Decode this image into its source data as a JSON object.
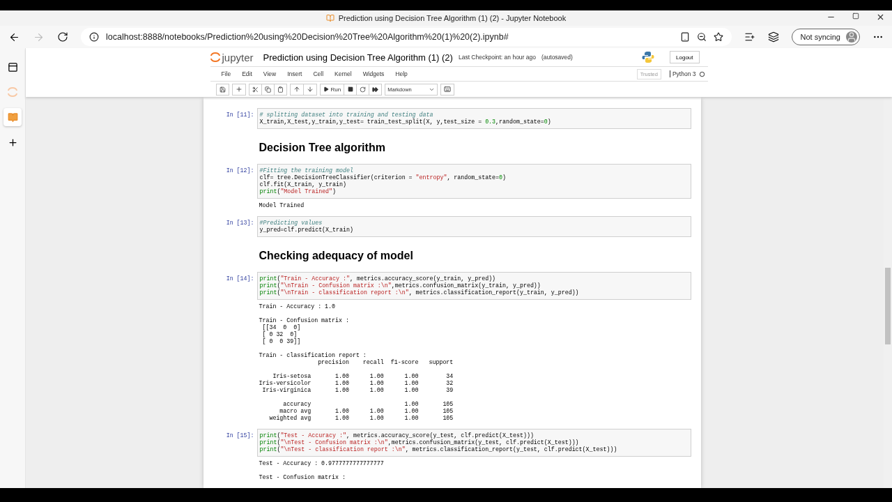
{
  "browser": {
    "tab_title": "Prediction using Decision Tree Algorithm (1) (2) - Jupyter Notebook",
    "url": "localhost:8888/notebooks/Prediction%20using%20Decision%20Tree%20Algorithm%20(1)%20(2).ipynb#",
    "profile": "Not syncing"
  },
  "jupyter": {
    "logo": "jupyter",
    "title": "Prediction using Decision Tree Algorithm (1) (2)",
    "checkpoint": "Last Checkpoint: an hour ago",
    "autosave": "(autosaved)",
    "logout": "Logout",
    "menu": [
      "File",
      "Edit",
      "View",
      "Insert",
      "Cell",
      "Kernel",
      "Widgets",
      "Help"
    ],
    "trusted": "Trusted",
    "kernel": "Python 3",
    "run": "Run",
    "cell_type": "Markdown"
  },
  "cells": [
    {
      "kind": "code",
      "prompt": "In [11]:",
      "lines": [
        [
          {
            "kind": "comment",
            "text": "# splitting dataset into training and testing data"
          }
        ],
        [
          {
            "kind": "plain",
            "text": "X_train,X_test,y_train,y_test= train_test_split(X, y,test_size = "
          },
          {
            "kind": "number",
            "text": "0.3"
          },
          {
            "kind": "plain",
            "text": ",random_state="
          },
          {
            "kind": "number",
            "text": "0"
          },
          {
            "kind": "plain",
            "text": ")"
          }
        ]
      ]
    },
    {
      "kind": "markdown",
      "heading": "Decision Tree algorithm"
    },
    {
      "kind": "code",
      "prompt": "In [12]:",
      "lines": [
        [
          {
            "kind": "comment",
            "text": "#Fitting the training model"
          }
        ],
        [
          {
            "kind": "plain",
            "text": "clf= tree.DecisionTreeClassifier(criterion = "
          },
          {
            "kind": "string",
            "text": "\"entropy\""
          },
          {
            "kind": "plain",
            "text": ", random_state="
          },
          {
            "kind": "number",
            "text": "0"
          },
          {
            "kind": "plain",
            "text": ")"
          }
        ],
        [
          {
            "kind": "plain",
            "text": "clf.fit(X_train, y_train)"
          }
        ],
        [
          {
            "kind": "builtin",
            "text": "print"
          },
          {
            "kind": "plain",
            "text": "("
          },
          {
            "kind": "string",
            "text": "\"Model Trained\""
          },
          {
            "kind": "plain",
            "text": ")"
          }
        ]
      ],
      "outputs": [
        "Model Trained"
      ]
    },
    {
      "kind": "code",
      "prompt": "In [13]:",
      "lines": [
        [
          {
            "kind": "comment",
            "text": "#Predicting values"
          }
        ],
        [
          {
            "kind": "plain",
            "text": "y_pred=clf.predict(X_train)"
          }
        ]
      ]
    },
    {
      "kind": "markdown",
      "heading": "Checking adequacy of model"
    },
    {
      "kind": "code",
      "prompt": "In [14]:",
      "lines": [
        [
          {
            "kind": "builtin",
            "text": "print"
          },
          {
            "kind": "plain",
            "text": "("
          },
          {
            "kind": "string",
            "text": "\"Train - Accuracy :\""
          },
          {
            "kind": "plain",
            "text": ", metrics.accuracy_score(y_train, y_pred))"
          }
        ],
        [
          {
            "kind": "builtin",
            "text": "print"
          },
          {
            "kind": "plain",
            "text": "("
          },
          {
            "kind": "string",
            "text": "\"\\nTrain - Confusion matrix :\\n\""
          },
          {
            "kind": "plain",
            "text": ",metrics.confusion_matrix(y_train, y_pred))"
          }
        ],
        [
          {
            "kind": "builtin",
            "text": "print"
          },
          {
            "kind": "plain",
            "text": "("
          },
          {
            "kind": "string",
            "text": "\"\\nTrain - classification report :\\n\""
          },
          {
            "kind": "plain",
            "text": ", metrics.classification_report(y_train, y_pred))"
          }
        ]
      ],
      "outputs": [
        "Train - Accuracy : 1.0",
        "Train - Confusion matrix :\n [[34  0  0]\n [ 0 32  0]\n [ 0  0 39]]",
        "Train - classification report :\n                 precision    recall  f1-score   support",
        "    Iris-setosa       1.00      1.00      1.00        34\nIris-versicolor       1.00      1.00      1.00        32\n Iris-virginica       1.00      1.00      1.00        39",
        "       accuracy                           1.00       105\n      macro avg       1.00      1.00      1.00       105\n   weighted avg       1.00      1.00      1.00       105"
      ]
    },
    {
      "kind": "code",
      "prompt": "In [15]:",
      "lines": [
        [
          {
            "kind": "builtin",
            "text": "print"
          },
          {
            "kind": "plain",
            "text": "("
          },
          {
            "kind": "string",
            "text": "\"Test - Accuracy :\""
          },
          {
            "kind": "plain",
            "text": ", metrics.accuracy_score(y_test, clf.predict(X_test)))"
          }
        ],
        [
          {
            "kind": "builtin",
            "text": "print"
          },
          {
            "kind": "plain",
            "text": "("
          },
          {
            "kind": "string",
            "text": "\"\\nTest - Confusion matrix :\\n\""
          },
          {
            "kind": "plain",
            "text": ",metrics.confusion_matrix(y_test, clf.predict(X_test)))"
          }
        ],
        [
          {
            "kind": "builtin",
            "text": "print"
          },
          {
            "kind": "plain",
            "text": "("
          },
          {
            "kind": "string",
            "text": "\"\\nTest - classification report :\\n\""
          },
          {
            "kind": "plain",
            "text": ", metrics.classification_report(y_test, clf.predict(X_test)))"
          }
        ]
      ],
      "outputs": [
        "Test - Accuracy : 0.9777777777777777",
        "Test - Confusion matrix :"
      ]
    }
  ]
}
